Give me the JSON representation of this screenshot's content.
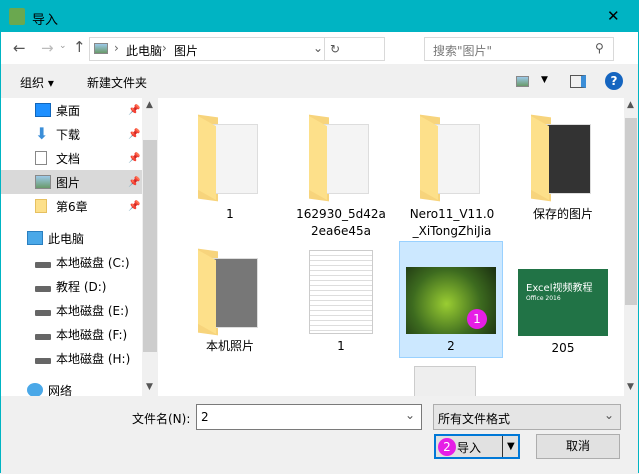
{
  "window": {
    "title": "导入",
    "close": "✕"
  },
  "nav": {
    "path": [
      "此电脑",
      "图片"
    ],
    "search_placeholder": "搜索\"图片\""
  },
  "toolbar": {
    "organize": "组织 ▾",
    "new_folder": "新建文件夹",
    "help": "?"
  },
  "sidebar": {
    "quick": [
      {
        "label": "桌面"
      },
      {
        "label": "下载"
      },
      {
        "label": "文档"
      },
      {
        "label": "图片"
      },
      {
        "label": "第6章"
      }
    ],
    "this_pc": "此电脑",
    "drives": [
      {
        "label": "本地磁盘 (C:)"
      },
      {
        "label": "教程 (D:)"
      },
      {
        "label": "本地磁盘 (E:)"
      },
      {
        "label": "本地磁盘 (F:)"
      },
      {
        "label": "本地磁盘 (H:)"
      }
    ],
    "network": "网络"
  },
  "files": [
    {
      "name": "1",
      "type": "folder"
    },
    {
      "name": "162930_5d42a2ea6e45a",
      "type": "folder"
    },
    {
      "name": "Nero11_V11.0_XiTongZhiJia",
      "type": "folder"
    },
    {
      "name": "保存的图片",
      "type": "folder"
    },
    {
      "name": "本机照片",
      "type": "folder"
    },
    {
      "name": "1",
      "type": "document"
    },
    {
      "name": "2",
      "type": "image",
      "selected": true,
      "badge": "1"
    },
    {
      "name": "205",
      "type": "image",
      "thumb_title": "Excel视频教程",
      "thumb_sub": "Office 2016"
    }
  ],
  "bottom": {
    "filename_label": "文件名(N):",
    "filename_value": "2",
    "filetype": "所有文件格式",
    "import": "导入",
    "import_badge": "2",
    "cancel": "取消"
  },
  "colors": {
    "titlebar": "#00b4c3",
    "selected": "#cce8ff",
    "badge": "#e61ee6",
    "accent": "#0078d7"
  }
}
